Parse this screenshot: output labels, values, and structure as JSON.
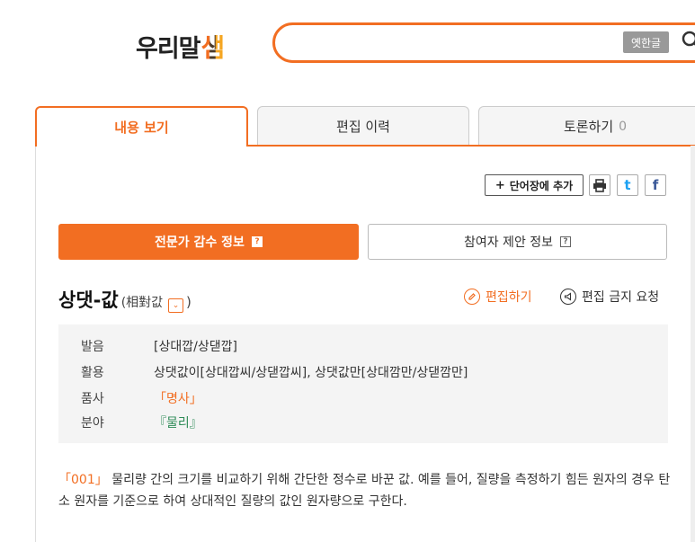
{
  "header": {
    "logo_text": "우리말",
    "logo_mark": "샘",
    "search_value": "",
    "oldhangul_label": "옛한글",
    "search_icon": "search-icon"
  },
  "tabs": [
    {
      "label": "내용 보기"
    },
    {
      "label": "편집 이력"
    },
    {
      "label": "토론하기",
      "count": "0"
    }
  ],
  "actions": {
    "wordbook_plus": "+",
    "wordbook_label": "단어장에 추가",
    "twitter": "t",
    "facebook": "f"
  },
  "subtabs": {
    "expert": "전문가 감수 정보",
    "user": "참여자 제안 정보",
    "help": "?"
  },
  "entry": {
    "headword": "상댓-값",
    "hanja_open": "(相對값",
    "hanja_toggle": "⌄",
    "hanja_close": ")",
    "edit_label": "편집하기",
    "noedit_label": "편집 금지 요청",
    "info": {
      "pron_label": "발음",
      "pron_value": "[상대깝/상댇깝]",
      "conj_label": "활용",
      "conj_value": "상댓값이[상대깝씨/상댇깝씨], 상댓값만[상대깜만/상댇깜만]",
      "pos_label": "품사",
      "pos_value": "「명사」",
      "field_label": "분야",
      "field_value": "『물리』"
    },
    "definition_num": "「001」",
    "definition_text": "물리량 간의 크기를 비교하기 위해 간단한 정수로 바꾼 값. 예를 들어, 질량을 측정하기 힘든 원자의 경우 탄소 원자를 기준으로 하여 상대적인 질량의 값인 원자량으로 구한다."
  },
  "colors": {
    "accent": "#f26e22",
    "green": "#2e8b57"
  }
}
